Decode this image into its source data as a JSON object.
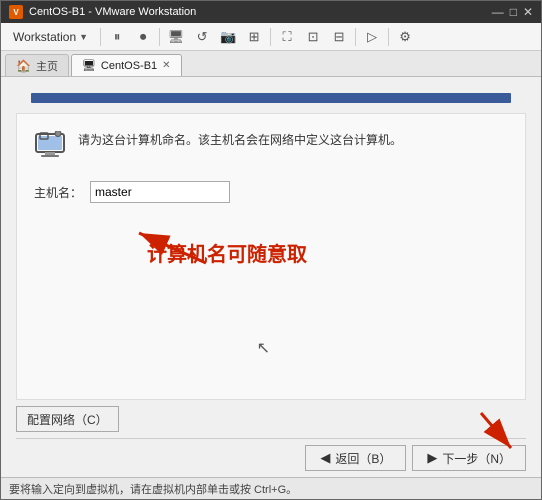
{
  "titlebar": {
    "title": "CentOS-B1 - VMware Workstation",
    "app_icon": "vm",
    "controls": [
      "—",
      "□",
      "✕"
    ]
  },
  "menubar": {
    "items": [
      {
        "label": "Workstation",
        "has_dropdown": true
      }
    ],
    "toolbar_icons": [
      "pause",
      "pause2",
      "monitor",
      "refresh",
      "snapshot",
      "clone",
      "fullscreen",
      "zoom",
      "settings"
    ]
  },
  "tabs": [
    {
      "label": "主页",
      "icon": "home",
      "active": false,
      "closeable": false
    },
    {
      "label": "CentOS-B1",
      "icon": "vm",
      "active": true,
      "closeable": true
    }
  ],
  "progress_bar": {
    "filled": true,
    "color": "#3a5a9a"
  },
  "description": {
    "icon": "computer",
    "text": "请为这台计算机命名。该主机名会在网络中定义这台计算机。"
  },
  "hostname": {
    "label": "主机名：",
    "value": "master",
    "placeholder": ""
  },
  "annotation": {
    "text": "计算机名可随意取"
  },
  "network_config": {
    "label": "配置网络（C）"
  },
  "nav_buttons": {
    "back": {
      "label": "返回（B）",
      "icon": "◀"
    },
    "next": {
      "label": "下一步（N）",
      "icon": "▶"
    }
  },
  "status_bar": {
    "text": "要将输入定向到虚拟机，请在虚拟机内部单击或按 Ctrl+G。"
  }
}
